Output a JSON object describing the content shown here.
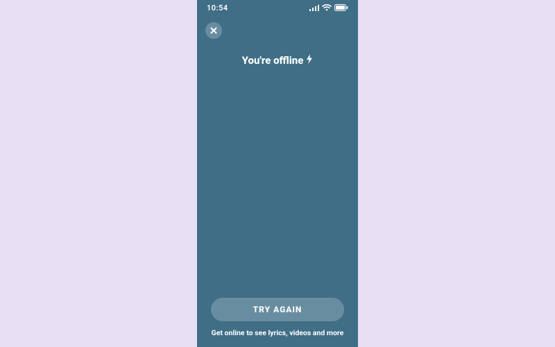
{
  "statusbar": {
    "time": "10:54"
  },
  "header": {
    "title": "You're offline"
  },
  "footer": {
    "button_label": "TRY AGAIN",
    "subtext": "Get online to see lyrics, videos and more"
  }
}
